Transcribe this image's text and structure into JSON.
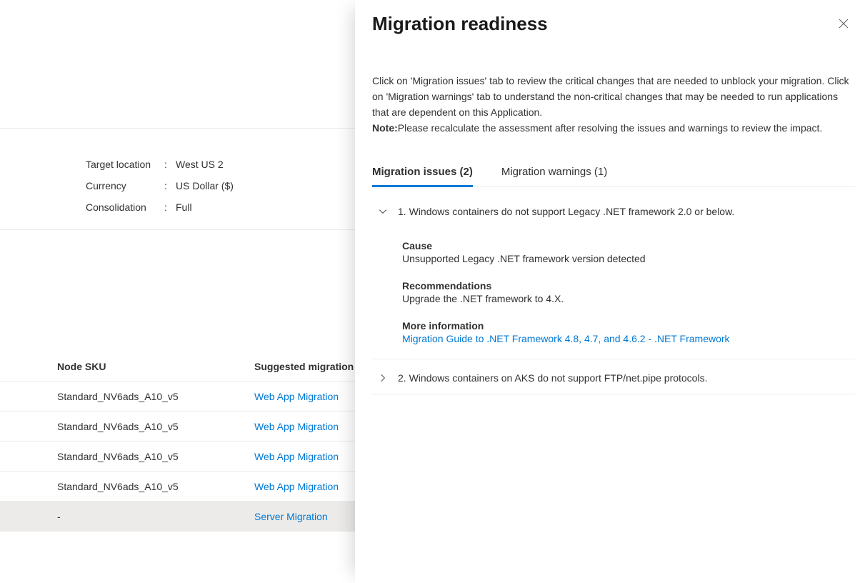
{
  "assessment": {
    "props": {
      "target_location_label": "Target location",
      "target_location_value": "West US 2",
      "currency_label": "Currency",
      "currency_value": "US Dollar ($)",
      "consolidation_label": "Consolidation",
      "consolidation_value": "Full"
    },
    "table": {
      "header_sku": "Node SKU",
      "header_tool": "Suggested migration",
      "rows": [
        {
          "sku": "Standard_NV6ads_A10_v5",
          "tool": "Web App Migration"
        },
        {
          "sku": "Standard_NV6ads_A10_v5",
          "tool": "Web App Migration"
        },
        {
          "sku": "Standard_NV6ads_A10_v5",
          "tool": "Web App Migration"
        },
        {
          "sku": "Standard_NV6ads_A10_v5",
          "tool": "Web App Migration"
        },
        {
          "sku": "-",
          "tool": "Server Migration"
        }
      ]
    }
  },
  "panel": {
    "title": "Migration readiness",
    "description_part1": "Click on 'Migration issues' tab to review the critical changes that are needed to unblock your migration. Click on 'Migration warnings' tab to understand the non-critical changes that may be needed to run applications that are dependent on this Application.",
    "note_label": "Note:",
    "note_text": "Please recalculate the assessment after resolving the issues and warnings to review the impact.",
    "tabs": {
      "issues_label": "Migration issues (2)",
      "warnings_label": "Migration warnings (1)"
    },
    "issues": [
      {
        "number": "1.",
        "title": "Windows containers do not support Legacy .NET framework 2.0 or below.",
        "cause_h": "Cause",
        "cause_t": "Unsupported Legacy .NET framework version detected",
        "rec_h": "Recommendations",
        "rec_t": "Upgrade the .NET framework to 4.X.",
        "info_h": "More information",
        "info_link": "Migration Guide to .NET Framework 4.8, 4.7, and 4.6.2 - .NET Framework"
      },
      {
        "number": "2.",
        "title": "Windows containers on AKS do not support FTP/net.pipe protocols."
      }
    ]
  }
}
